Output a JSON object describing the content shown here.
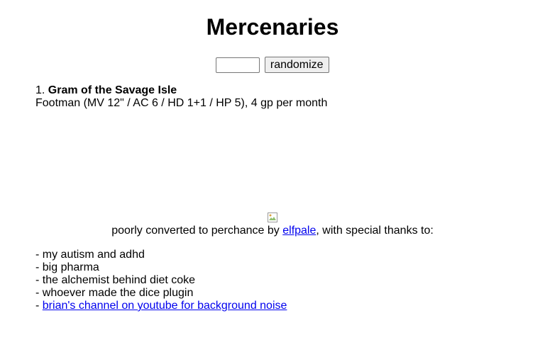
{
  "header": {
    "title": "Mercenaries"
  },
  "controls": {
    "count_value": "",
    "randomize_label": "randomize"
  },
  "results": [
    {
      "index": "1.",
      "name": "Gram of the Savage Isle",
      "details": "Footman (MV 12\" / AC 6 / HD 1+1 / HP 5), 4 gp per month"
    }
  ],
  "footer": {
    "image_icon": "broken-image-icon",
    "credit_prefix": "poorly converted to perchance by",
    "credit_link": "elfpale",
    "credit_suffix": ", with special thanks to:",
    "thanks_dash": "-",
    "thanks": [
      "my autism and adhd",
      "big pharma",
      "the alchemist behind diet coke",
      "whoever made the dice plugin"
    ],
    "thanks_link": "brian's channel on youtube for background noise"
  },
  "colors": {
    "link": "#0000ee",
    "text": "#000000",
    "background": "#ffffff"
  }
}
